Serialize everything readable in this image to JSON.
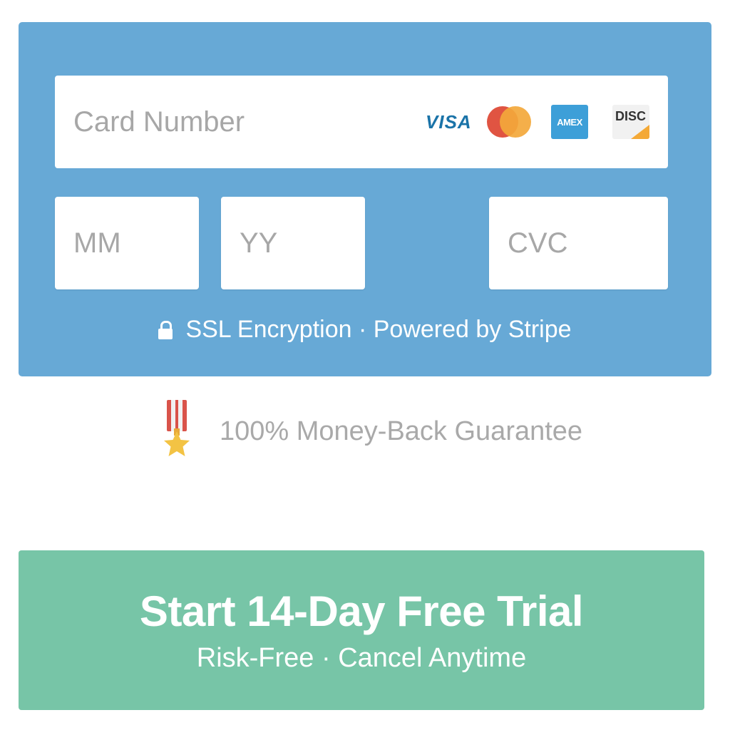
{
  "card_form": {
    "card_number_placeholder": "Card Number",
    "card_brands": [
      {
        "name": "visa-logo",
        "label": "VISA"
      },
      {
        "name": "mastercard-logo",
        "label": ""
      },
      {
        "name": "amex-logo",
        "label": "AMEX"
      },
      {
        "name": "discover-logo",
        "label": "DISC"
      }
    ],
    "month_placeholder": "MM",
    "year_placeholder": "YY",
    "cvc_placeholder": "CVC",
    "security_text": "SSL Encryption · Powered by Stripe",
    "security_icon": "lock-icon"
  },
  "guarantee": {
    "icon": "medal-icon",
    "text": "100% Money-Back Guarantee"
  },
  "cta": {
    "title": "Start 14-Day Free Trial",
    "subtitle": "Risk-Free · Cancel Anytime"
  },
  "colors": {
    "panel": "#67a9d6",
    "cta": "#77c5a7",
    "placeholder": "#a7a7a7",
    "guarantee_text": "#a9a9a9"
  }
}
